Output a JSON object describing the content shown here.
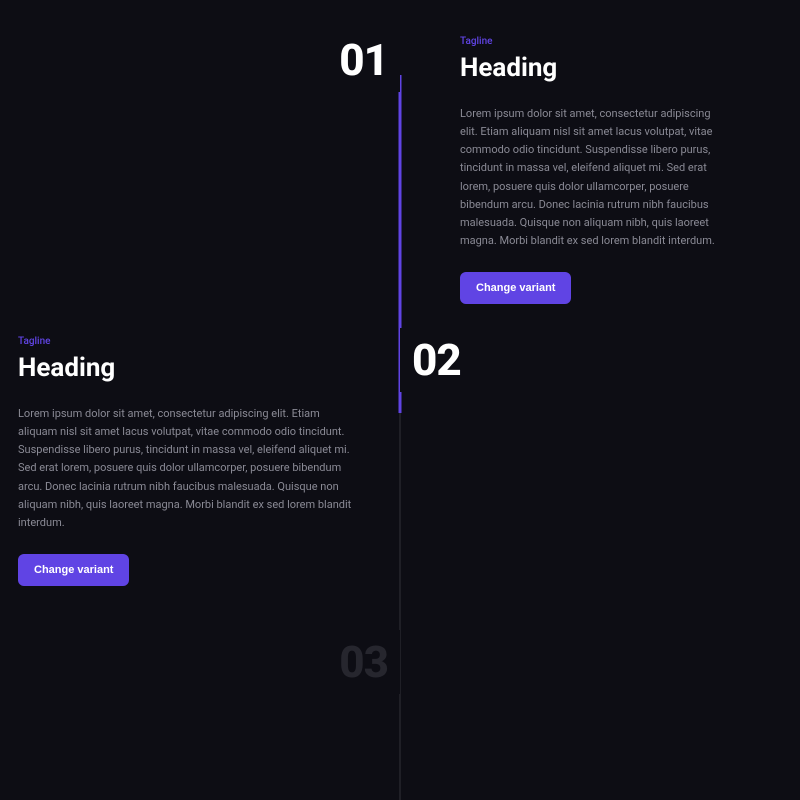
{
  "steps": [
    {
      "number": "01",
      "tagline": "Tagline",
      "heading": "Heading",
      "body": "Lorem ipsum dolor sit amet, consectetur adipiscing elit. Etiam aliquam nisl sit amet lacus volutpat, vitae commodo odio tincidunt. Suspendisse libero purus, tincidunt in massa vel, eleifend aliquet mi. Sed erat lorem, posuere quis dolor ullamcorper, posuere bibendum arcu. Donec lacinia rutrum nibh faucibus malesuada. Quisque non aliquam nibh, quis laoreet magna. Morbi blandit ex sed lorem blandit interdum.",
      "button": "Change variant"
    },
    {
      "number": "02",
      "tagline": "Tagline",
      "heading": "Heading",
      "body": "Lorem ipsum dolor sit amet, consectetur adipiscing elit. Etiam aliquam nisl sit amet lacus volutpat, vitae commodo odio tincidunt. Suspendisse libero purus, tincidunt in massa vel, eleifend aliquet mi. Sed erat lorem, posuere quis dolor ullamcorper, posuere bibendum arcu. Donec lacinia rutrum nibh faucibus malesuada. Quisque non aliquam nibh, quis laoreet magna. Morbi blandit ex sed lorem blandit interdum.",
      "button": "Change variant"
    },
    {
      "number": "03",
      "tagline": "",
      "heading": "",
      "body": "",
      "button": ""
    }
  ],
  "colors": {
    "accent": "#6044e4",
    "background": "#0d0d14"
  }
}
